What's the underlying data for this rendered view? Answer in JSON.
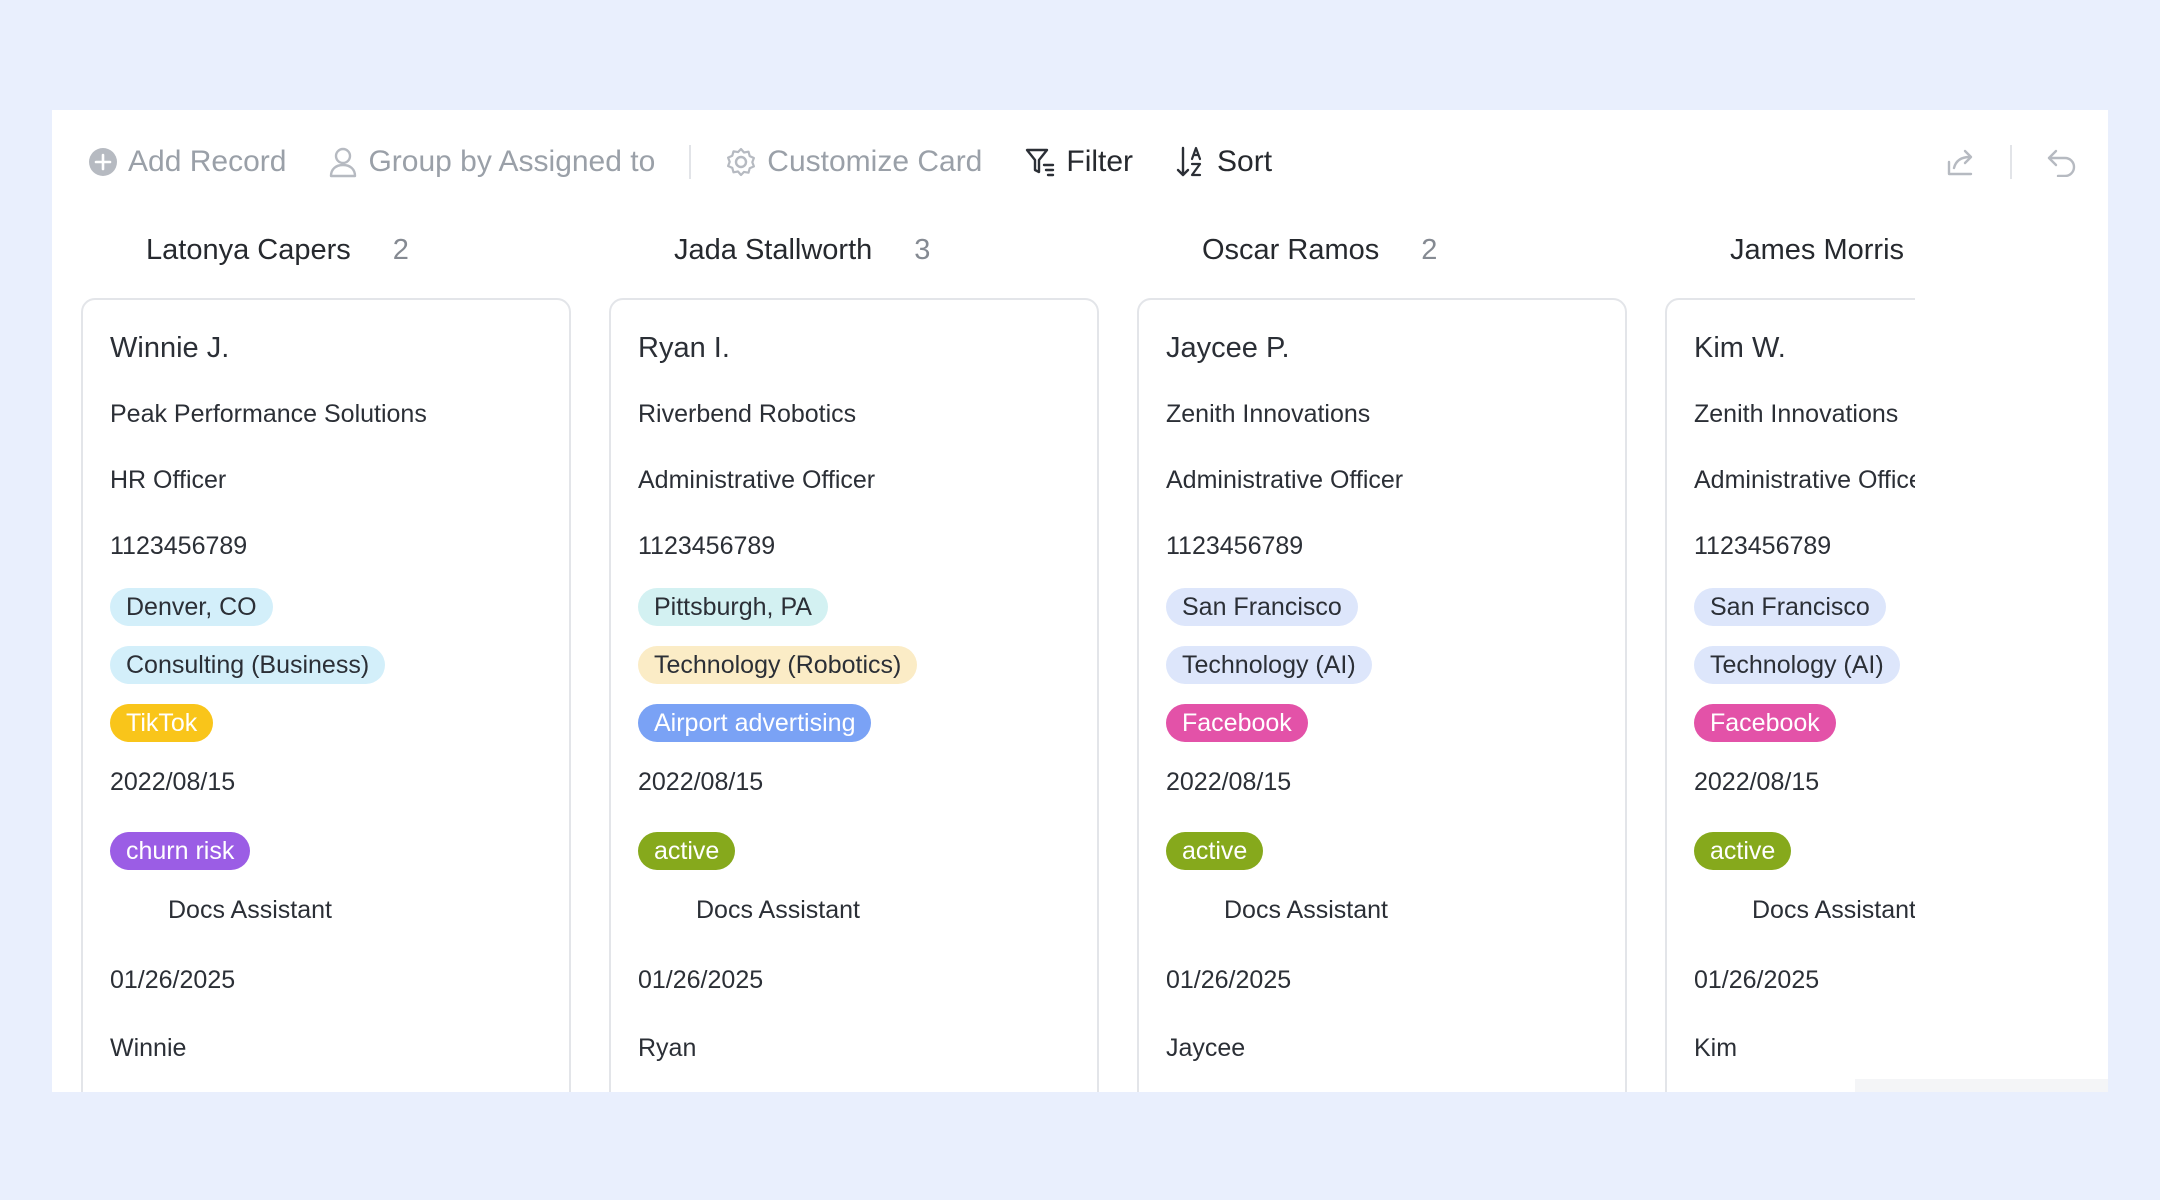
{
  "toolbar": {
    "add_record": "Add Record",
    "group_by": "Group by Assigned to",
    "customize_card": "Customize Card",
    "filter": "Filter",
    "sort": "Sort"
  },
  "columns": [
    {
      "name": "Latonya Capers",
      "count": "2",
      "card": {
        "name": "Winnie J.",
        "company": "Peak Performance Solutions",
        "role": "HR Officer",
        "phone": "1123456789",
        "location": "Denver, CO",
        "industry": "Consulting (Business)",
        "channel": "TikTok",
        "date": "2022/08/15",
        "status": "churn risk",
        "assistant": "Docs Assistant",
        "updated": "01/26/2025",
        "contact": "Winnie"
      }
    },
    {
      "name": "Jada Stallworth",
      "count": "3",
      "card": {
        "name": "Ryan I.",
        "company": "Riverbend Robotics",
        "role": "Administrative Officer",
        "phone": "1123456789",
        "location": "Pittsburgh, PA",
        "industry": "Technology (Robotics)",
        "channel": "Airport advertising",
        "date": "2022/08/15",
        "status": "active",
        "assistant": "Docs Assistant",
        "updated": "01/26/2025",
        "contact": "Ryan"
      }
    },
    {
      "name": "Oscar Ramos",
      "count": "2",
      "card": {
        "name": "Jaycee P.",
        "company": "Zenith Innovations",
        "role": "Administrative Officer",
        "phone": "1123456789",
        "location": "San Francisco",
        "industry": "Technology (AI)",
        "channel": "Facebook",
        "date": "2022/08/15",
        "status": "active",
        "assistant": "Docs Assistant",
        "updated": "01/26/2025",
        "contact": "Jaycee"
      }
    },
    {
      "name": "James Morris",
      "count": "",
      "card": {
        "name": "Kim W.",
        "company": "Zenith Innovations",
        "role": "Administrative Officer",
        "phone": "1123456789",
        "location": "San Francisco",
        "industry": "Technology (AI)",
        "channel": "Facebook",
        "date": "2022/08/15",
        "status": "active",
        "assistant": "Docs Assistant",
        "updated": "01/26/2025",
        "contact": "Kim"
      }
    }
  ],
  "colors": {
    "location_teal": "#d3f1f2",
    "location_blue": "#dde6fb",
    "industry_cyan": "#d3effa",
    "industry_yellow": "#fbecc6",
    "industry_blue": "#dde6fb",
    "tiktok": "#f9c51a",
    "airport": "#7aa2f5",
    "facebook": "#e352a8",
    "churn_risk": "#9b5de5",
    "active": "#86a91c"
  }
}
